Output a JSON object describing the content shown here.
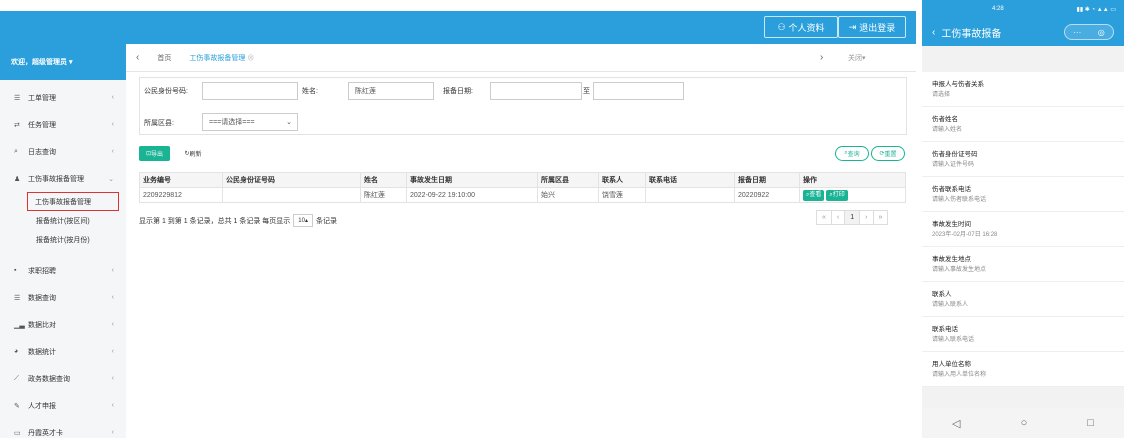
{
  "header": {
    "profile_label": "个人资料",
    "logout_label": "退出登录"
  },
  "sidebar": {
    "welcome": "欢迎，超级管理员",
    "items": [
      {
        "label": "工单管理",
        "icon": "list-icon"
      },
      {
        "label": "任务管理",
        "icon": "swap-icon"
      },
      {
        "label": "日志查询",
        "icon": "search-icon"
      },
      {
        "label": "工伤事故报备管理",
        "icon": "bell-icon",
        "expanded": true
      },
      {
        "label": "求职招聘",
        "icon": "briefcase-icon"
      },
      {
        "label": "数据查询",
        "icon": "list-icon"
      },
      {
        "label": "数据比对",
        "icon": "bar-chart-icon"
      },
      {
        "label": "数据统计",
        "icon": "pie-chart-icon"
      },
      {
        "label": "政务数据查询",
        "icon": "wand-icon"
      },
      {
        "label": "人才申报",
        "icon": "edit-icon"
      },
      {
        "label": "丹霞英才卡",
        "icon": "card-icon"
      }
    ],
    "subitems": [
      {
        "label": "工伤事故报备管理",
        "active": true
      },
      {
        "label": "报备统计(按区间)"
      },
      {
        "label": "报备统计(按月份)"
      }
    ]
  },
  "tabs": {
    "home": "首页",
    "current": "工伤事故报备管理",
    "close": "关闭"
  },
  "filter": {
    "id_label": "公民身份号码:",
    "id_value": "",
    "name_label": "姓名:",
    "name_value": "陈红莲",
    "date_label": "报备日期:",
    "date_sep": "至",
    "district_label": "所属区县:",
    "district_value": "===请选择==="
  },
  "buttons": {
    "export": "导出",
    "refresh": "刷新",
    "query": "查询",
    "reset": "重置"
  },
  "table": {
    "headers": [
      "业务编号",
      "公民身份证号码",
      "姓名",
      "事故发生日期",
      "所属区县",
      "联系人",
      "联系电话",
      "报备日期",
      "操作"
    ],
    "rows": [
      [
        "2209229812",
        "",
        "陈红莲",
        "2022-09-22 19:10:00",
        "始兴",
        "饶雪莲",
        "",
        "20220922",
        ""
      ]
    ],
    "view": "查看",
    "print": "打印"
  },
  "pagination": {
    "info": "显示第 1 到第 1 条记录，总共 1 条记录 每页显示",
    "page_size": "10",
    "suffix": "条记录",
    "current_page": "1"
  },
  "phone": {
    "time": "4:28",
    "title": "工伤事故报备",
    "fields": [
      {
        "label": "申报人与伤者关系",
        "value": "请选择"
      },
      {
        "label": "伤者姓名",
        "value": "请输入姓名"
      },
      {
        "label": "伤者身份证号码",
        "value": "请输入证件号码"
      },
      {
        "label": "伤者联系电话",
        "value": "请输入伤者联系电话"
      },
      {
        "label": "事故发生时间",
        "value": "2023年-02月-07日 16:28"
      },
      {
        "label": "事故发生地点",
        "value": "请输入事故发生地点"
      },
      {
        "label": "联系人",
        "value": "请输入联系人"
      },
      {
        "label": "联系电话",
        "value": "请输入联系电话"
      },
      {
        "label": "用人单位名称",
        "value": "请输入用人单位名称"
      }
    ]
  }
}
